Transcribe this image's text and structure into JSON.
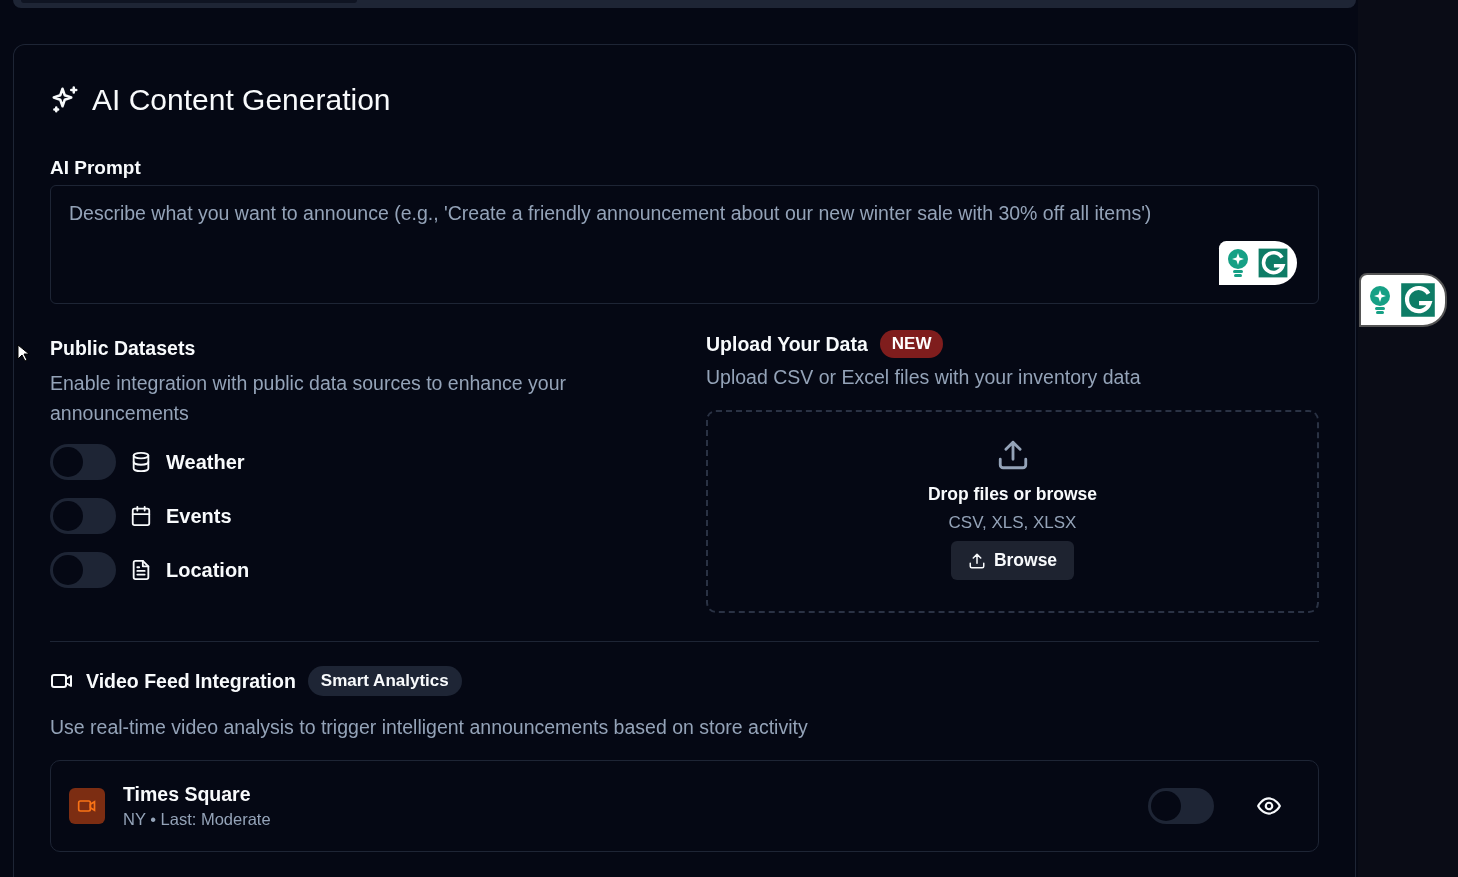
{
  "section": {
    "title": "AI Content Generation"
  },
  "prompt": {
    "label": "AI Prompt",
    "placeholder": "Describe what you want to announce (e.g., 'Create a friendly announcement about our new winter sale with 30% off all items')"
  },
  "public_datasets": {
    "title": "Public Datasets",
    "description": "Enable integration with public data sources to enhance your announcements",
    "items": [
      {
        "label": "Weather",
        "on": false
      },
      {
        "label": "Events",
        "on": false
      },
      {
        "label": "Location",
        "on": false
      }
    ]
  },
  "upload": {
    "title": "Upload Your Data",
    "badge": "NEW",
    "description": "Upload CSV or Excel files with your inventory data",
    "drop_text": "Drop files or browse",
    "formats": "CSV, XLS, XLSX",
    "button": "Browse"
  },
  "video": {
    "title": "Video Feed Integration",
    "badge": "Smart Analytics",
    "description": "Use real-time video analysis to trigger intelligent announcements based on store activity",
    "feeds": [
      {
        "name": "Times Square",
        "meta": "NY • Last: Moderate",
        "color": "#7c2d12",
        "on": false
      }
    ]
  }
}
